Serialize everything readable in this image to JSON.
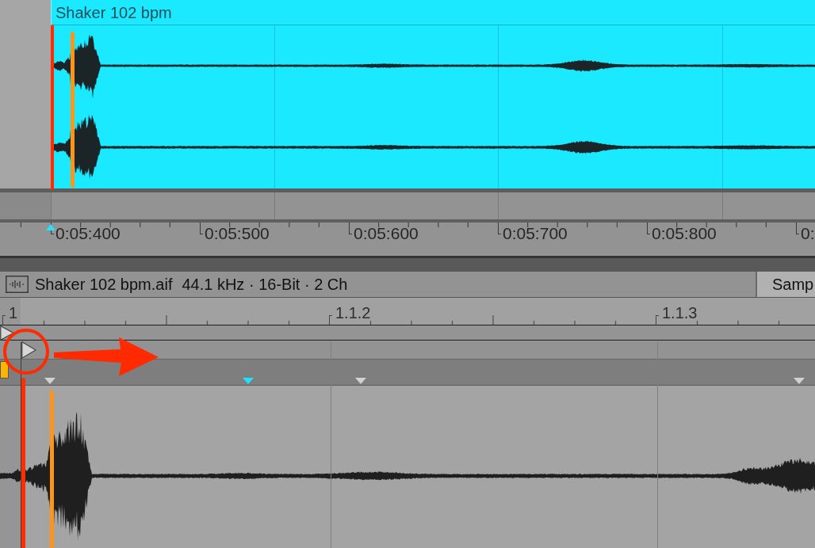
{
  "arrangement": {
    "clip_title": "Shaker 102 bpm"
  },
  "time_ruler": {
    "labels": [
      "0:05:400",
      "0:05:500",
      "0:05:600",
      "0:05:700",
      "0:05:800",
      "0:"
    ]
  },
  "clip_view": {
    "file_name": "Shaker 102 bpm.aif",
    "format": "44.1 kHz · 16-Bit · 2 Ch",
    "sample_button": "Samp"
  },
  "beat_ruler": {
    "labels": [
      "1",
      "1.1.2",
      "1.1.3"
    ]
  },
  "warp_markers": [
    {
      "selected": false
    },
    {
      "selected": true
    },
    {
      "selected": false
    },
    {
      "selected": false
    }
  ]
}
